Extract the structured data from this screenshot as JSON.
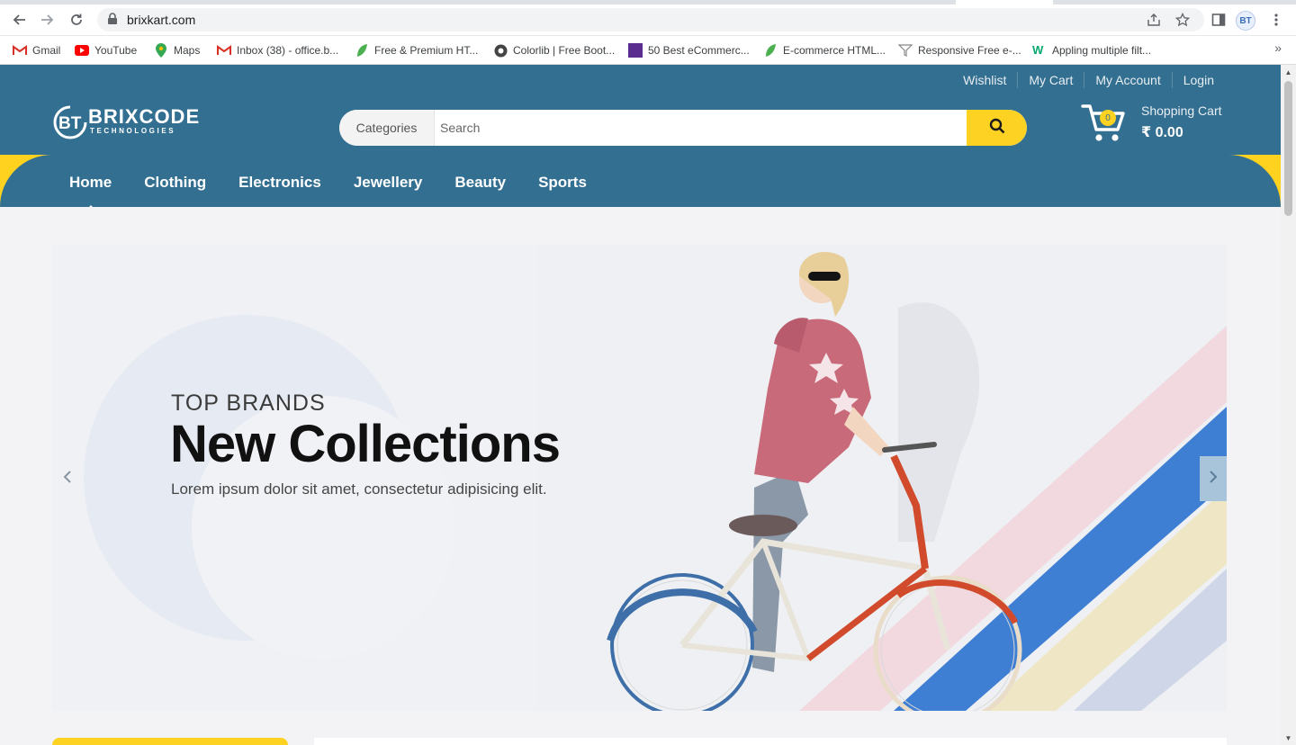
{
  "browser": {
    "url": "brixkart.com",
    "bookmarks": [
      {
        "label": "Gmail",
        "icon": "gmail-icon"
      },
      {
        "label": "YouTube",
        "icon": "youtube-icon"
      },
      {
        "label": "Maps",
        "icon": "maps-icon"
      },
      {
        "label": "Inbox (38) - office.b...",
        "icon": "gmail-icon"
      },
      {
        "label": "Free & Premium HT...",
        "icon": "leaf-icon"
      },
      {
        "label": "Colorlib | Free Boot...",
        "icon": "colorlib-icon"
      },
      {
        "label": "50 Best eCommerc...",
        "icon": "colorlib-square-icon"
      },
      {
        "label": "E-commerce HTML...",
        "icon": "leaf-icon"
      },
      {
        "label": "Responsive Free e-...",
        "icon": "funnel-icon"
      },
      {
        "label": "Appling multiple filt...",
        "icon": "w3schools-icon"
      }
    ],
    "more_bookmarks": "»"
  },
  "site": {
    "toplinks": [
      "Wishlist",
      "My Cart",
      "My Account",
      "Login"
    ],
    "logo": {
      "name": "BRIXCODE",
      "tagline": "TECHNOLOGIES",
      "mark": "BT"
    },
    "search": {
      "category_label": "Categories",
      "placeholder": "Search"
    },
    "cart": {
      "count": "0",
      "label": "Shopping Cart",
      "amount": "₹ 0.00"
    },
    "nav": [
      "Home",
      "Clothing",
      "Electronics",
      "Jewellery",
      "Beauty",
      "Sports"
    ],
    "active_nav": "Home",
    "hero": {
      "kicker": "TOP BRANDS",
      "title": "New Collections",
      "subtitle": "Lorem ipsum dolor sit amet, consectetur adipisicing elit."
    },
    "colors": {
      "primary": "#336f91",
      "accent": "#fdd223"
    }
  }
}
